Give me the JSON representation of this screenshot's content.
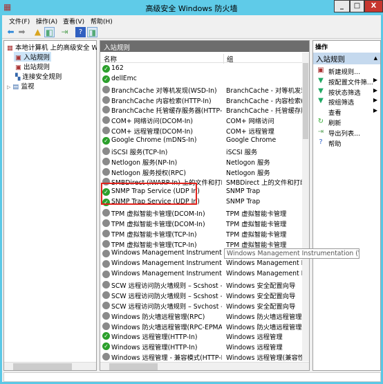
{
  "window": {
    "title": "高级安全 Windows 防火墙",
    "minimize": "_",
    "maximize": "□",
    "close": "X"
  },
  "menu": [
    "文件(F)",
    "操作(A)",
    "查看(V)",
    "帮助(H)"
  ],
  "tree": {
    "root": "本地计算机 上的高级安全 Windows 防火墙",
    "items": [
      "入站规则",
      "出站规则",
      "连接安全规则",
      "监视"
    ]
  },
  "middle": {
    "header": "入站规则",
    "columns": [
      "名称",
      "组"
    ],
    "rows": [
      {
        "name": "162",
        "group": "",
        "enabled": true
      },
      {
        "name": "dellEmc",
        "group": "",
        "enabled": true
      },
      {
        "name": "BranchCache 对等机发现(WSD-In)",
        "group": "BranchCache - 对等机发现...",
        "enabled": false
      },
      {
        "name": "BranchCache 内容检索(HTTP-In)",
        "group": "BranchCache - 内容检索(...",
        "enabled": false
      },
      {
        "name": "BranchCache 托管缓存服务器(HTTP-In)",
        "group": "BranchCache - 托管缓存服...",
        "enabled": false
      },
      {
        "name": "COM+ 网络访问(DCOM-In)",
        "group": "COM+ 网络访问",
        "enabled": false
      },
      {
        "name": "COM+ 远程管理(DCOM-In)",
        "group": "COM+ 远程管理",
        "enabled": false
      },
      {
        "name": "Google Chrome (mDNS-In)",
        "group": "Google Chrome",
        "enabled": true
      },
      {
        "name": "iSCSI 服务(TCP-In)",
        "group": "iSCSI 服务",
        "enabled": false
      },
      {
        "name": "Netlogon 服务(NP-In)",
        "group": "Netlogon 服务",
        "enabled": false
      },
      {
        "name": "Netlogon 服务授权(RPC)",
        "group": "Netlogon 服务",
        "enabled": false
      },
      {
        "name": "SMBDirect (iWARP-In) 上的文件和打印...",
        "group": "SMBDirect 上的文件和打印...",
        "enabled": false
      },
      {
        "name": "SNMP Trap Service (UDP In)",
        "group": "SNMP Trap",
        "enabled": true
      },
      {
        "name": "SNMP Trap Service (UDP In)",
        "group": "SNMP Trap",
        "enabled": true
      },
      {
        "name": "TPM 虚拟智能卡管理(DCOM-In)",
        "group": "TPM 虚拟智能卡管理",
        "enabled": false
      },
      {
        "name": "TPM 虚拟智能卡管理(DCOM-In)",
        "group": "TPM 虚拟智能卡管理",
        "enabled": false
      },
      {
        "name": "TPM 虚拟智能卡管理(TCP-In)",
        "group": "TPM 虚拟智能卡管理",
        "enabled": false
      },
      {
        "name": "TPM 虚拟智能卡管理(TCP-In)",
        "group": "TPM 虚拟智能卡管理",
        "enabled": false
      },
      {
        "name": "Windows Management Instrumentati...",
        "group": "Windows Management Instrumentation (WMI)",
        "enabled": false
      },
      {
        "name": "Windows Management Instrumentati...",
        "group": "Windows Management In...",
        "enabled": false
      },
      {
        "name": "Windows Management Instrumentati...",
        "group": "Windows Management In...",
        "enabled": false
      },
      {
        "name": "SCW 远程访问防火墙规则 – Scshost - ...",
        "group": "Windows 安全配置向导",
        "enabled": false
      },
      {
        "name": "SCW 远程访问防火墙规则 – Scshost - ...",
        "group": "Windows 安全配置向导",
        "enabled": false
      },
      {
        "name": "SCW 远程访问防火墙规则 – Svchost - T...",
        "group": "Windows 安全配置向导",
        "enabled": false
      },
      {
        "name": "Windows 防火墙远程管理(RPC)",
        "group": "Windows 防火墙远程管理",
        "enabled": false
      },
      {
        "name": "Windows 防火墙远程管理(RPC-EPMAP)",
        "group": "Windows 防火墙远程管理",
        "enabled": false
      },
      {
        "name": "Windows 远程管理(HTTP-In)",
        "group": "Windows 远程管理",
        "enabled": true
      },
      {
        "name": "Windows 远程管理(HTTP-In)",
        "group": "Windows 远程管理",
        "enabled": true
      },
      {
        "name": "Windows 远程管理 - 兼容模式(HTTP-In)",
        "group": "Windows 远程管理(兼容性)",
        "enabled": false
      }
    ],
    "tooltip": "Windows Management Instrumentation (WMI)"
  },
  "actions": {
    "header": "操作",
    "section": "入站规则",
    "items": [
      {
        "label": "新建规则...",
        "icon": "new-rule-icon",
        "submenu": false
      },
      {
        "label": "按配置文件筛...",
        "icon": "filter-icon",
        "submenu": true
      },
      {
        "label": "按状态筛选",
        "icon": "filter-icon",
        "submenu": true
      },
      {
        "label": "按组筛选",
        "icon": "filter-icon",
        "submenu": true
      },
      {
        "label": "查看",
        "icon": "",
        "submenu": true
      },
      {
        "label": "刷新",
        "icon": "refresh-icon",
        "submenu": false
      },
      {
        "label": "导出列表...",
        "icon": "export-icon",
        "submenu": false
      },
      {
        "label": "帮助",
        "icon": "help-icon",
        "submenu": false
      }
    ]
  },
  "colors": {
    "titlebar": "#5fcbe8",
    "highlight": "#e0211b",
    "enabled": "#2ca02c"
  }
}
